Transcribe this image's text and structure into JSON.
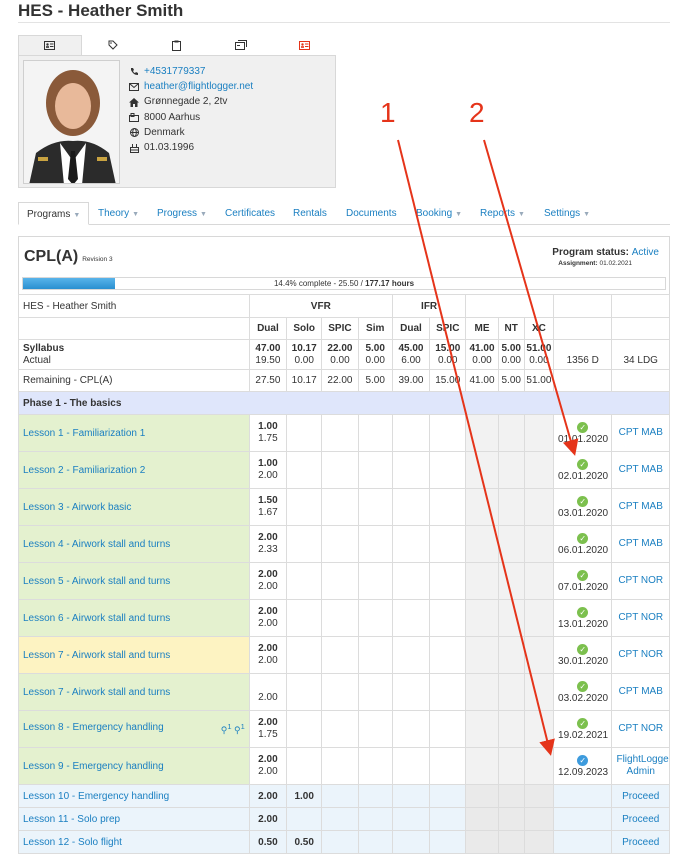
{
  "page_title": "HES - Heather Smith",
  "profile": {
    "phone": "+4531779337",
    "email": "heather@flightlogger.net",
    "street": "Grønnegade 2, 2tv",
    "city": "8000 Aarhus",
    "country": "Denmark",
    "birthdate": "01.03.1996"
  },
  "nav": [
    {
      "label": "Programs",
      "caret": true
    },
    {
      "label": "Theory",
      "caret": true
    },
    {
      "label": "Progress",
      "caret": true
    },
    {
      "label": "Certificates",
      "caret": false
    },
    {
      "label": "Rentals",
      "caret": false
    },
    {
      "label": "Documents",
      "caret": false
    },
    {
      "label": "Booking",
      "caret": true
    },
    {
      "label": "Reports",
      "caret": true
    },
    {
      "label": "Settings",
      "caret": true
    }
  ],
  "program": {
    "name": "CPL(A)",
    "revision": "Revision 3",
    "status_label": "Program status:",
    "status_value": "Active",
    "assignment_label": "Assignment:",
    "assignment_date": "01.02.2021",
    "progress_percent": 14.4,
    "progress_text": "14.4% complete - 25.50 / ",
    "progress_total": "177.17 hours"
  },
  "table": {
    "student": "HES - Heather Smith",
    "groups": {
      "vfr": "VFR",
      "ifr": "IFR"
    },
    "columns": [
      "Dual",
      "Solo",
      "SPIC",
      "Sim",
      "Dual",
      "SPIC",
      "ME",
      "NT",
      "XC"
    ],
    "syllabus_label": "Syllabus",
    "actual_label": "Actual",
    "syllabus": [
      "47.00",
      "10.17",
      "22.00",
      "5.00",
      "45.00",
      "15.00",
      "41.00",
      "5.00",
      "51.00"
    ],
    "actual": [
      "19.50",
      "0.00",
      "0.00",
      "0.00",
      "6.00",
      "0.00",
      "0.00",
      "0.00",
      "0.00"
    ],
    "actual_extra": [
      "1356 D",
      "34 LDG"
    ],
    "remaining_label": "Remaining - CPL(A)",
    "remaining": [
      "27.50",
      "10.17",
      "22.00",
      "5.00",
      "39.00",
      "15.00",
      "41.00",
      "5.00",
      "51.00"
    ],
    "phase": "Phase 1 - The basics",
    "lessons": [
      {
        "name": "Lesson 1 - Familiarization 1",
        "planned": "1.00",
        "done": "1.75",
        "date": "01.01.2020",
        "instructor": "CPT MAB"
      },
      {
        "name": "Lesson 2 - Familiarization 2",
        "planned": "1.00",
        "done": "2.00",
        "date": "02.01.2020",
        "instructor": "CPT MAB"
      },
      {
        "name": "Lesson 3 - Airwork basic",
        "planned": "1.50",
        "done": "1.67",
        "date": "03.01.2020",
        "instructor": "CPT MAB"
      },
      {
        "name": "Lesson 4 - Airwork stall and turns",
        "planned": "2.00",
        "done": "2.33",
        "date": "06.01.2020",
        "instructor": "CPT MAB"
      },
      {
        "name": "Lesson 5 - Airwork stall and turns",
        "planned": "2.00",
        "done": "2.00",
        "date": "07.01.2020",
        "instructor": "CPT NOR"
      },
      {
        "name": "Lesson 6 - Airwork stall and turns",
        "planned": "2.00",
        "done": "2.00",
        "date": "13.01.2020",
        "instructor": "CPT NOR"
      },
      {
        "name": "Lesson 7 - Airwork stall and turns",
        "planned": "2.00",
        "done": "2.00",
        "date": "30.01.2020",
        "instructor": "CPT NOR"
      },
      {
        "name": "Lesson 7 - Airwork stall and turns",
        "planned": "",
        "done": "2.00",
        "date": "03.02.2020",
        "instructor": "CPT MAB"
      },
      {
        "name": "Lesson 8 - Emergency handling",
        "planned": "2.00",
        "done": "1.75",
        "date": "19.02.2021",
        "instructor": "CPT NOR",
        "badges": [
          "1",
          "1"
        ]
      },
      {
        "name": "Lesson 9 - Emergency handling",
        "planned": "2.00",
        "done": "2.00",
        "date": "12.09.2023",
        "instructor": "FlightLogger Admin"
      }
    ],
    "pending": [
      {
        "name": "Lesson 10 - Emergency handling",
        "dual": "2.00",
        "solo": "1.00",
        "action": "Proceed"
      },
      {
        "name": "Lesson 11 - Solo prep",
        "dual": "2.00",
        "solo": "",
        "action": "Proceed"
      },
      {
        "name": "Lesson 12 - Solo flight",
        "dual": "0.50",
        "solo": "0.50",
        "action": "Proceed"
      }
    ]
  },
  "annotations": {
    "one": "1",
    "two": "2"
  },
  "colors": {
    "link": "#1a7fc1",
    "lesson_done_bg": "#e4f1cf",
    "lesson_warn_bg": "#fdf3c2",
    "phase_bg": "#dfe6fb",
    "annotation": "#e5341a",
    "check_green": "#7cc04e",
    "check_blue": "#3d9bdd"
  }
}
